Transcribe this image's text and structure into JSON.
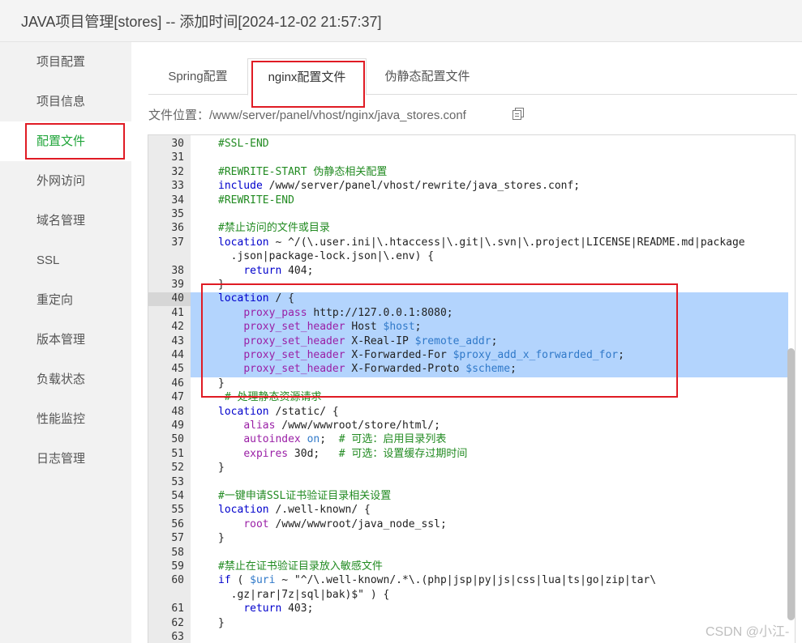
{
  "window": {
    "title": "JAVA项目管理[stores] -- 添加时间[2024-12-02 21:57:37]"
  },
  "sidebar": {
    "items": [
      {
        "label": "项目配置"
      },
      {
        "label": "项目信息"
      },
      {
        "label": "配置文件"
      },
      {
        "label": "外网访问"
      },
      {
        "label": "域名管理"
      },
      {
        "label": "SSL"
      },
      {
        "label": "重定向"
      },
      {
        "label": "版本管理"
      },
      {
        "label": "负载状态"
      },
      {
        "label": "性能监控"
      },
      {
        "label": "日志管理"
      }
    ],
    "active_index": 2
  },
  "tabs": [
    {
      "label": "Spring配置"
    },
    {
      "label": "nginx配置文件"
    },
    {
      "label": "伪静态配置文件"
    }
  ],
  "file": {
    "label": "文件位置：",
    "path": "/www/server/panel/vhost/nginx/java_stores.conf",
    "copy_icon": "copy-icon"
  },
  "editor": {
    "lines": [
      {
        "n": "30",
        "text": "    #SSL-END"
      },
      {
        "n": "31",
        "text": ""
      },
      {
        "n": "32",
        "text": "    #REWRITE-START 伪静态相关配置"
      },
      {
        "n": "33",
        "text": "    include /www/server/panel/vhost/rewrite/java_stores.conf;"
      },
      {
        "n": "34",
        "text": "    #REWRITE-END"
      },
      {
        "n": "35",
        "text": ""
      },
      {
        "n": "36",
        "text": "    #禁止访问的文件或目录"
      },
      {
        "n": "37",
        "text": "    location ~ ^/(\\.user.ini|\\.htaccess|\\.git|\\.svn|\\.project|LICENSE|README.md|package"
      },
      {
        "n": "",
        "text": "      .json|package-lock.json|\\.env) {"
      },
      {
        "n": "38",
        "text": "        return 404;"
      },
      {
        "n": "39",
        "text": "    }"
      },
      {
        "n": "40",
        "text": "    location / {"
      },
      {
        "n": "41",
        "text": "        proxy_pass http://127.0.0.1:8080;"
      },
      {
        "n": "42",
        "text": "        proxy_set_header Host $host;"
      },
      {
        "n": "43",
        "text": "        proxy_set_header X-Real-IP $remote_addr;"
      },
      {
        "n": "44",
        "text": "        proxy_set_header X-Forwarded-For $proxy_add_x_forwarded_for;"
      },
      {
        "n": "45",
        "text": "        proxy_set_header X-Forwarded-Proto $scheme;"
      },
      {
        "n": "46",
        "text": "    }"
      },
      {
        "n": "47",
        "text": "     # 处理静态资源请求"
      },
      {
        "n": "48",
        "text": "    location /static/ {"
      },
      {
        "n": "49",
        "text": "        alias /www/wwwroot/store/html/;"
      },
      {
        "n": "50",
        "text": "        autoindex on;  # 可选：启用目录列表"
      },
      {
        "n": "51",
        "text": "        expires 30d;   # 可选：设置缓存过期时间"
      },
      {
        "n": "52",
        "text": "    }"
      },
      {
        "n": "53",
        "text": ""
      },
      {
        "n": "54",
        "text": "    #一键申请SSL证书验证目录相关设置"
      },
      {
        "n": "55",
        "text": "    location /.well-known/ {"
      },
      {
        "n": "56",
        "text": "        root /www/wwwroot/java_node_ssl;"
      },
      {
        "n": "57",
        "text": "    }"
      },
      {
        "n": "58",
        "text": ""
      },
      {
        "n": "59",
        "text": "    #禁止在证书验证目录放入敏感文件"
      },
      {
        "n": "60",
        "text": "    if ( $uri ~ \"^/\\.well-known/.*\\.(php|jsp|py|js|css|lua|ts|go|zip|tar\\"
      },
      {
        "n": "",
        "text": "      .gz|rar|7z|sql|bak)$\" ) {"
      },
      {
        "n": "61",
        "text": "        return 403;"
      },
      {
        "n": "62",
        "text": "    }"
      },
      {
        "n": "63",
        "text": ""
      }
    ]
  },
  "watermark": "CSDN @小江-",
  "colors": {
    "accent": "#20a53a",
    "highlight_box": "#e01b24",
    "selection": "#b3d4fd"
  }
}
